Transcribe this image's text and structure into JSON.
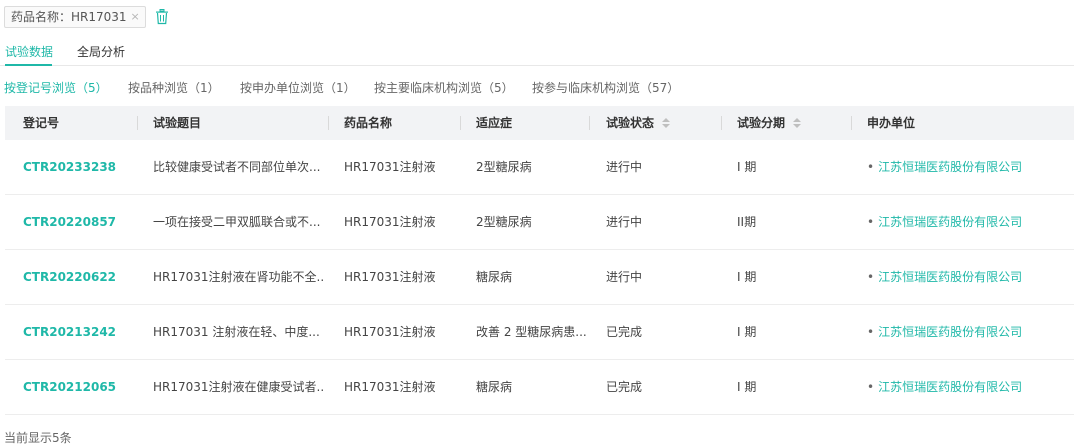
{
  "filter": {
    "tag_label": "药品名称：HR17031",
    "close_glyph": "×",
    "trash_icon": "trash-icon"
  },
  "tabs": [
    {
      "label": "试验数据",
      "active": true
    },
    {
      "label": "全局分析",
      "active": false
    }
  ],
  "browse": [
    {
      "label": "按登记号浏览（5）",
      "active": true
    },
    {
      "label": "按品种浏览（1）",
      "active": false
    },
    {
      "label": "按申办单位浏览（1）",
      "active": false
    },
    {
      "label": "按主要临床机构浏览（5）",
      "active": false
    },
    {
      "label": "按参与临床机构浏览（57）",
      "active": false
    }
  ],
  "table": {
    "columns": [
      "登记号",
      "试验题目",
      "药品名称",
      "适应症",
      "试验状态",
      "试验分期",
      "申办单位"
    ],
    "rows": [
      {
        "reg": "CTR20233238",
        "title": "比较健康受试者不同部位单次...",
        "drug": "HR17031注射液",
        "indication": "2型糖尿病",
        "status": "进行中",
        "phase": "I 期",
        "sponsor": "江苏恒瑞医药股份有限公司"
      },
      {
        "reg": "CTR20220857",
        "title": "一项在接受二甲双胍联合或不...",
        "drug": "HR17031注射液",
        "indication": "2型糖尿病",
        "status": "进行中",
        "phase": "II期",
        "sponsor": "江苏恒瑞医药股份有限公司"
      },
      {
        "reg": "CTR20220622",
        "title": "HR17031注射液在肾功能不全...",
        "drug": "HR17031注射液",
        "indication": "糖尿病",
        "status": "进行中",
        "phase": "I 期",
        "sponsor": "江苏恒瑞医药股份有限公司"
      },
      {
        "reg": "CTR20213242",
        "title": "HR17031 注射液在轻、中度...",
        "drug": "HR17031注射液",
        "indication": "改善 2 型糖尿病患...",
        "status": "已完成",
        "phase": "I 期",
        "sponsor": "江苏恒瑞医药股份有限公司"
      },
      {
        "reg": "CTR20212065",
        "title": "HR17031注射液在健康受试者...",
        "drug": "HR17031注射液",
        "indication": "糖尿病",
        "status": "已完成",
        "phase": "I 期",
        "sponsor": "江苏恒瑞医药股份有限公司"
      }
    ]
  },
  "footer": {
    "count_text": "当前显示5条"
  },
  "colors": {
    "accent": "#1fb8a8",
    "header_bg": "#f2f3f5"
  }
}
